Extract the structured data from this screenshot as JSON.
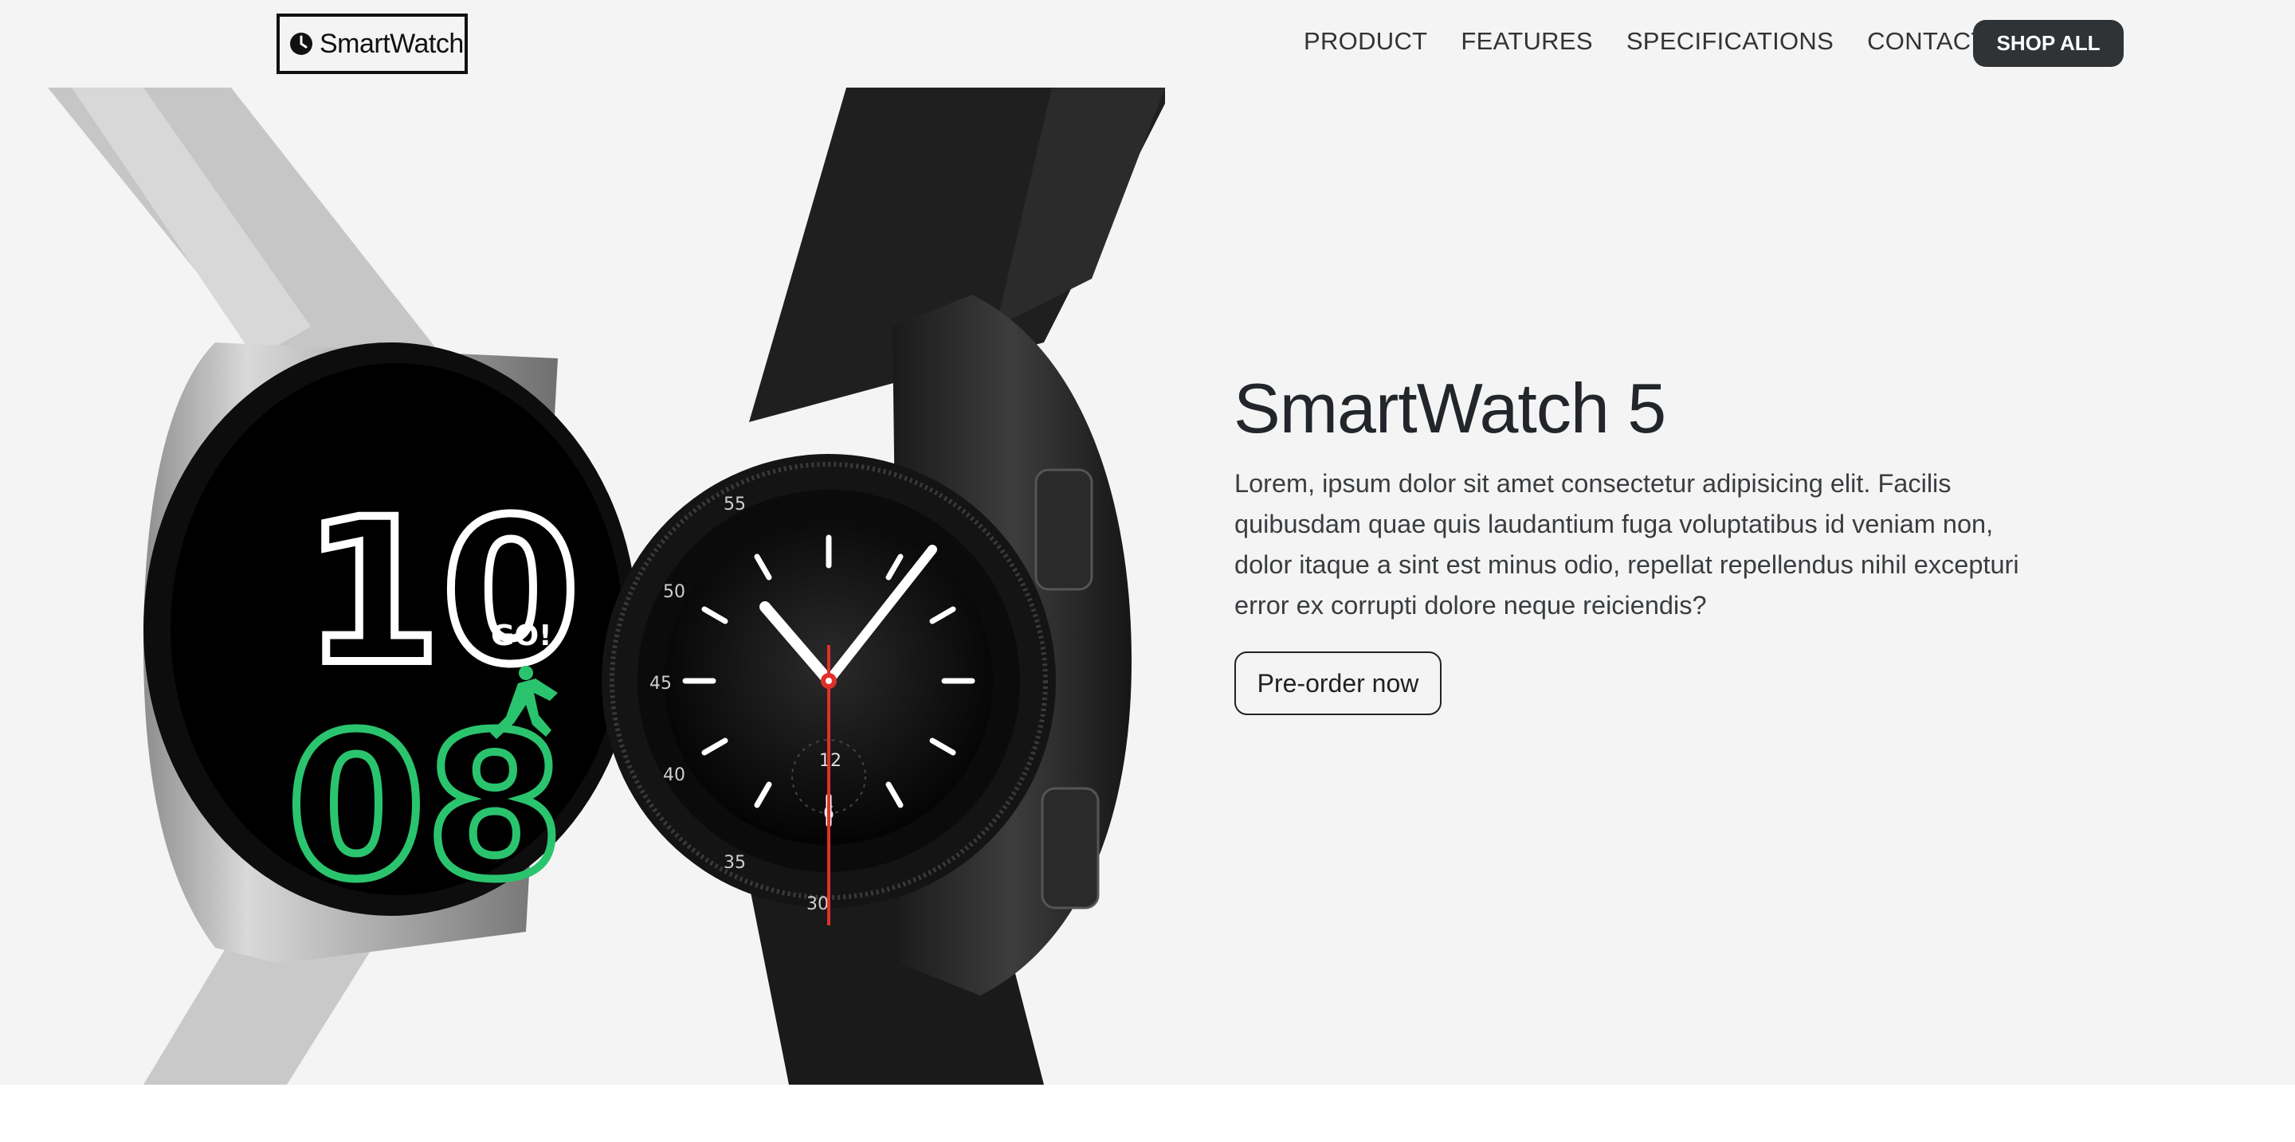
{
  "header": {
    "logo_text": "SmartWatch",
    "logo_icon": "clock-icon",
    "nav": [
      {
        "label": "PRODUCT"
      },
      {
        "label": "FEATURES"
      },
      {
        "label": "SPECIFICATIONS"
      },
      {
        "label": "CONTACT"
      }
    ],
    "shop_all_label": "SHOP ALL"
  },
  "hero": {
    "title": "SmartWatch 5",
    "description": "Lorem, ipsum dolor sit amet consectetur adipisicing elit. Facilis quibusdam quae quis laudantium fuga voluptatibus id veniam non, dolor itaque a sint est minus odio, repellat repellendus nihil excepturi error ex corrupti dolore neque reiciendis?",
    "cta_label": "Pre-order now"
  },
  "watch_faces": {
    "left": {
      "hour": "10",
      "minute": "08",
      "go_text": "GO!"
    },
    "right": {
      "bezel_numbers": [
        "55",
        "50",
        "45",
        "40",
        "35",
        "30"
      ],
      "subdial_numbers": [
        "12",
        "6"
      ]
    }
  },
  "colors": {
    "hero_bg": "#f4f4f4",
    "shop_button_bg": "#2f3336",
    "accent_green": "#2bc46e",
    "accent_red": "#e0302a"
  }
}
